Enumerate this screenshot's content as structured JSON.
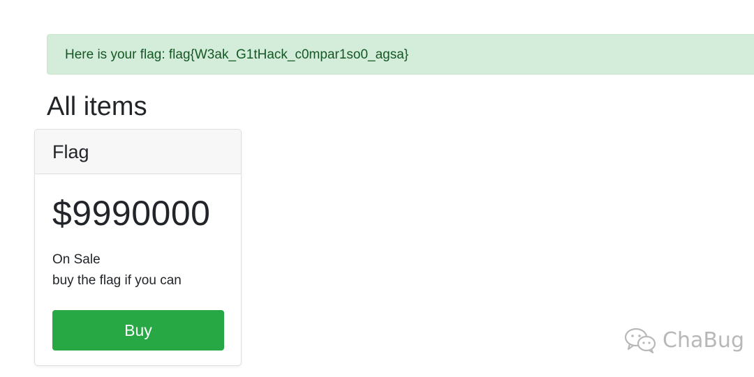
{
  "alert": {
    "message": "Here is your flag: flag{W3ak_G1tHack_c0mpar1so0_agsa}",
    "color": "#155724",
    "background": "#d4edda"
  },
  "page": {
    "title": "All items"
  },
  "item": {
    "name": "Flag",
    "price": "$9990000",
    "status": "On Sale",
    "description": "buy the flag if you can",
    "buy_label": "Buy",
    "button_color": "#28a745"
  },
  "watermark": {
    "icon": "wechat-icon",
    "text": "ChaBug"
  }
}
